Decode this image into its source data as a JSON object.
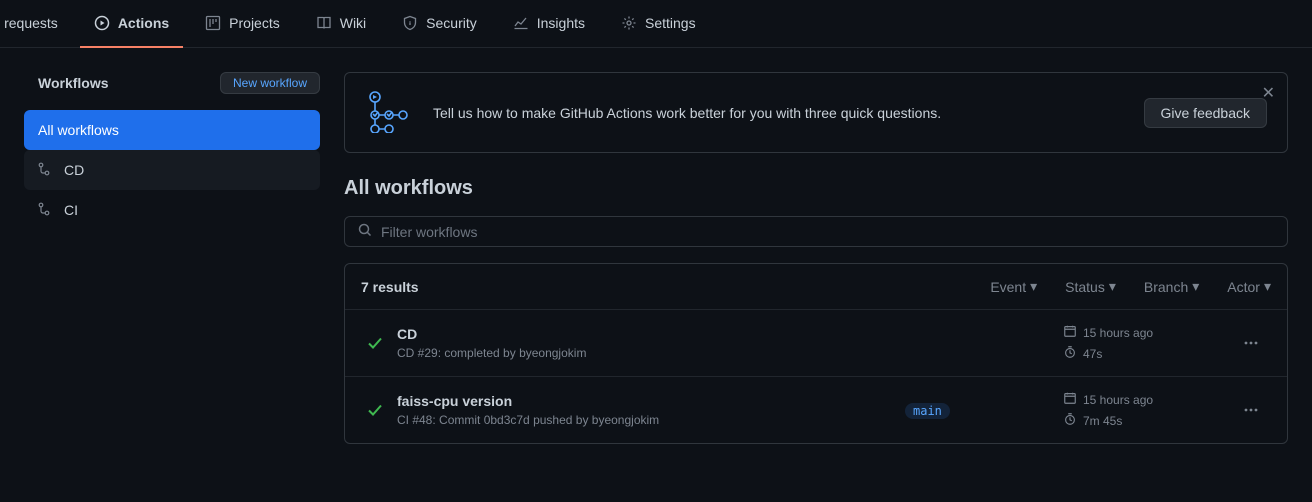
{
  "nav": {
    "pull": "ll requests",
    "actions": "Actions",
    "projects": "Projects",
    "wiki": "Wiki",
    "security": "Security",
    "insights": "Insights",
    "settings": "Settings"
  },
  "sidebar": {
    "title": "Workflows",
    "new_workflow_label": "New workflow",
    "items": [
      {
        "label": "All workflows"
      },
      {
        "label": "CD"
      },
      {
        "label": "CI"
      }
    ]
  },
  "banner": {
    "text": "Tell us how to make GitHub Actions work better for you with three quick questions.",
    "button": "Give feedback"
  },
  "page": {
    "title": "All workflows",
    "filter_placeholder": "Filter workflows",
    "results_count": "7 results"
  },
  "filters": {
    "event": "Event",
    "status": "Status",
    "branch": "Branch",
    "actor": "Actor"
  },
  "runs": [
    {
      "status": "success",
      "title": "CD",
      "subtitle": "CD #29: completed by byeongjokim",
      "branch": "",
      "age": "15 hours ago",
      "duration": "47s"
    },
    {
      "status": "success",
      "title": "faiss-cpu version",
      "subtitle": "CI #48: Commit 0bd3c7d pushed by byeongjokim",
      "branch": "main",
      "age": "15 hours ago",
      "duration": "7m 45s"
    }
  ]
}
